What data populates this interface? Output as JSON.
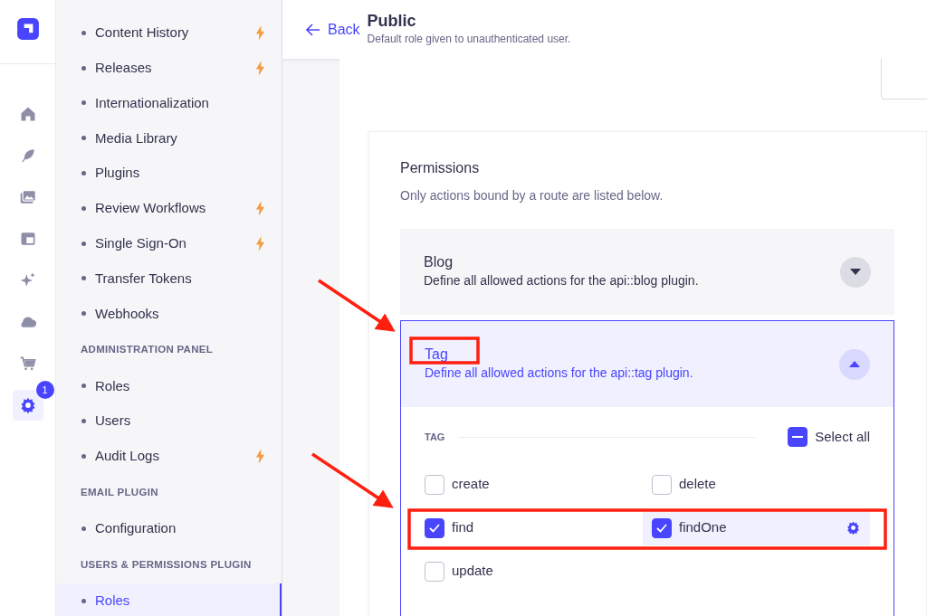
{
  "rail": [
    {
      "selected": false
    },
    {
      "selected": false
    },
    {
      "selected": false
    },
    {
      "selected": false
    },
    {
      "selected": false
    },
    {
      "selected": false
    },
    {
      "selected": false
    },
    {
      "selected": false
    },
    {
      "selected": true,
      "badge": "1"
    }
  ],
  "sidebar": [
    {
      "items": [
        {
          "label": "Content History",
          "premium": true,
          "selected": false
        },
        {
          "label": "Releases",
          "premium": true,
          "selected": false
        },
        {
          "label": "Internationalization",
          "premium": false,
          "selected": false
        },
        {
          "label": "Media Library",
          "premium": false,
          "selected": false
        },
        {
          "label": "Plugins",
          "premium": false,
          "selected": false
        },
        {
          "label": "Review Workflows",
          "premium": true,
          "selected": false
        },
        {
          "label": "Single Sign-On",
          "premium": true,
          "selected": false
        },
        {
          "label": "Transfer Tokens",
          "premium": false,
          "selected": false
        },
        {
          "label": "Webhooks",
          "premium": false,
          "selected": false
        }
      ]
    },
    {
      "heading": "ADMINISTRATION PANEL",
      "items": [
        {
          "label": "Roles",
          "premium": false,
          "selected": false
        },
        {
          "label": "Users",
          "premium": false,
          "selected": false
        },
        {
          "label": "Audit Logs",
          "premium": true,
          "selected": false
        }
      ]
    },
    {
      "heading": "EMAIL PLUGIN",
      "items": [
        {
          "label": "Configuration",
          "premium": false,
          "selected": false
        }
      ]
    },
    {
      "heading": "USERS & PERMISSIONS PLUGIN",
      "items": [
        {
          "label": "Roles",
          "premium": false,
          "selected": true
        }
      ]
    }
  ],
  "header": {
    "back": "Back",
    "title": "Public",
    "subtitle": "Default role given to unauthenticated user."
  },
  "permissions": {
    "title": "Permissions",
    "subtitle": "Only actions bound by a route are listed below.",
    "groups": [
      {
        "name": "Blog",
        "description": "Define all allowed actions for the api::blog plugin.",
        "expanded": false
      },
      {
        "name": "Tag",
        "description": "Define all allowed actions for the api::tag plugin.",
        "expanded": true,
        "section": "TAG",
        "select_all": {
          "label": "Select all",
          "checked": false,
          "indeterminate": true
        },
        "actions": [
          {
            "label": "create",
            "checked": false,
            "selected": false
          },
          {
            "label": "delete",
            "checked": false,
            "selected": false
          },
          {
            "label": "find",
            "checked": true,
            "selected": false
          },
          {
            "label": "findOne",
            "checked": true,
            "selected": true
          },
          {
            "label": "update",
            "checked": false,
            "selected": false
          }
        ]
      }
    ]
  }
}
